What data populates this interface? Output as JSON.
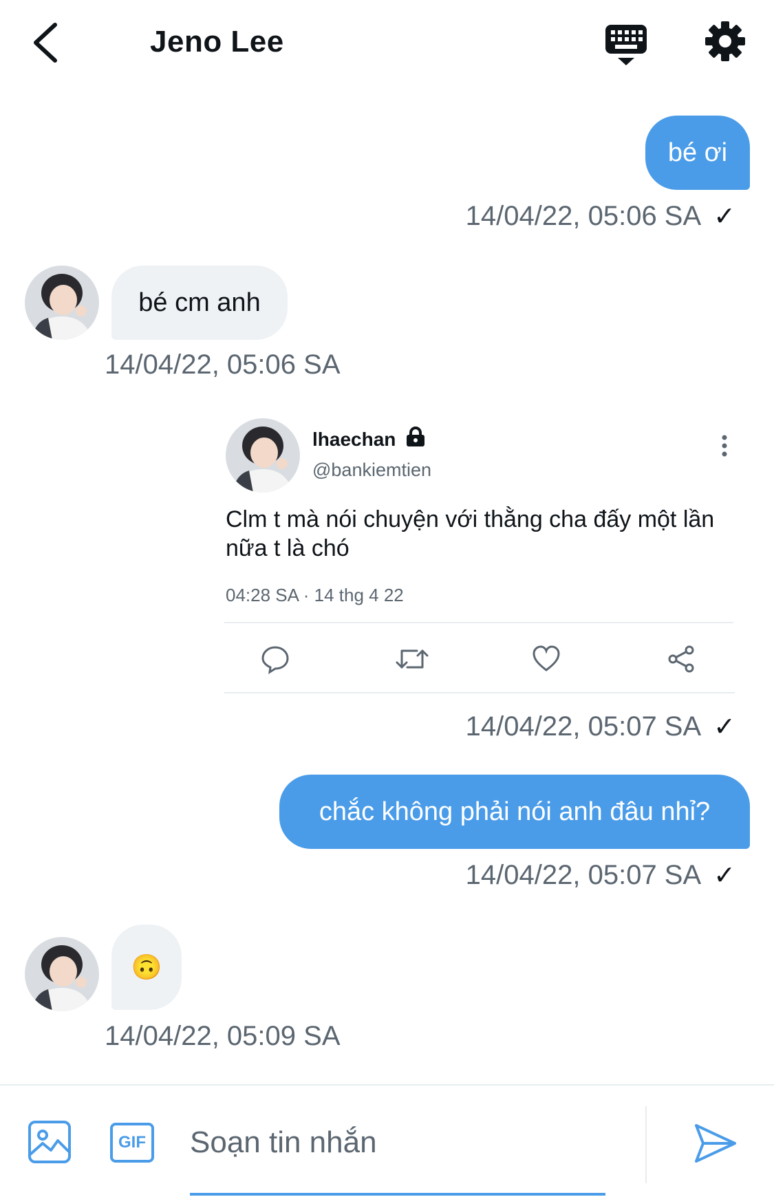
{
  "header": {
    "title": "Jeno Lee",
    "back_icon": "chevron-left-icon",
    "keyboard_icon": "keyboard-icon",
    "settings_icon": "gear-icon"
  },
  "messages": [
    {
      "direction": "out",
      "text": "bé ơi",
      "timestamp": "14/04/22, 05:06 SA",
      "status": "✓"
    },
    {
      "direction": "in",
      "text": "bé cm anh",
      "timestamp": "14/04/22, 05:06 SA"
    },
    {
      "direction": "out",
      "tweet": {
        "name": "lhaechan",
        "handle": "@bankiemtien",
        "text": "Clm t mà nói chuyện với thằng cha đấy một lần nữa t là chó",
        "meta": "04:28 SA · 14 thg 4 22"
      },
      "timestamp": "14/04/22, 05:07 SA",
      "status": "✓"
    },
    {
      "direction": "out",
      "text": "chắc không phải nói anh đâu nhỉ?",
      "timestamp": "14/04/22, 05:07 SA",
      "status": "✓"
    },
    {
      "direction": "in",
      "text": "🙃",
      "timestamp": "14/04/22, 05:09 SA"
    }
  ],
  "composer": {
    "placeholder": "Soạn tin nhắn",
    "gif_label": "GIF",
    "image_icon": "image-icon",
    "send_icon": "send-icon"
  },
  "colors": {
    "accent": "#4a9ce9",
    "incoming_bubble": "#eef2f5",
    "secondary_text": "#5b6670"
  }
}
